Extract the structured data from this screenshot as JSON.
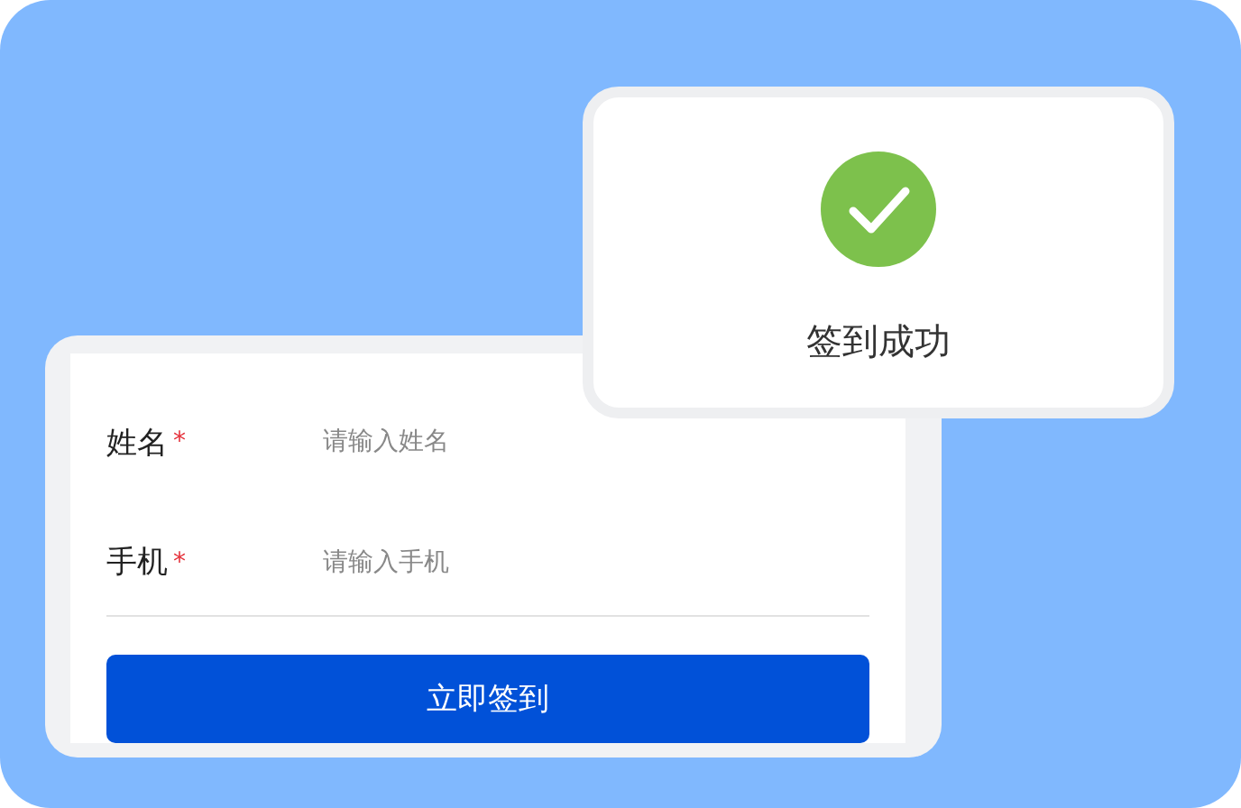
{
  "form": {
    "fields": [
      {
        "label": "姓名",
        "required_mark": "*",
        "placeholder": "请输入姓名"
      },
      {
        "label": "手机",
        "required_mark": "*",
        "placeholder": "请输入手机"
      }
    ],
    "submit_button": "立即签到"
  },
  "toast": {
    "message": "签到成功"
  }
}
